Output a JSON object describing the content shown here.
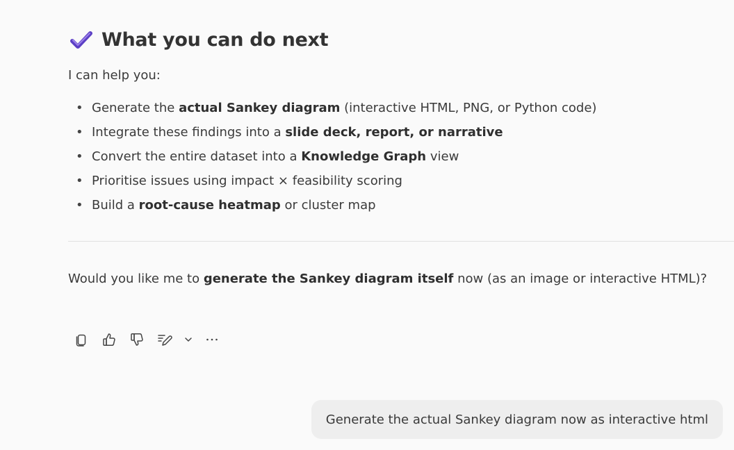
{
  "section": {
    "icon": "checkmark-icon",
    "title": "What you can do next"
  },
  "intro": "I can help you:",
  "options": [
    {
      "pre": "Generate the ",
      "bold": "actual Sankey diagram",
      "post": " (interactive HTML, PNG, or Python code)"
    },
    {
      "pre": "Integrate these findings into a ",
      "bold": "slide deck, report, or narrative",
      "post": ""
    },
    {
      "pre": "Convert the entire dataset into a ",
      "bold": "Knowledge Graph",
      "post": " view"
    },
    {
      "pre": "Prioritise issues using impact × feasibility scoring",
      "bold": "",
      "post": ""
    },
    {
      "pre": "Build a ",
      "bold": "root-cause heatmap",
      "post": " or cluster map"
    }
  ],
  "question": {
    "pre": "Would you like me to ",
    "bold": "generate the Sankey diagram itself",
    "post": " now (as an image or interactive HTML)?"
  },
  "actions": {
    "copy_icon": "copy-icon",
    "like_icon": "thumbs-up-icon",
    "dislike_icon": "thumbs-down-icon",
    "edit_icon": "edit-pen-icon",
    "dropdown_icon": "chevron-down-icon",
    "more_icon": "more-ellipsis-icon"
  },
  "user_message": "Generate the actual Sankey diagram now as interactive html",
  "colors": {
    "check_dark": "#5b3fc4",
    "check_light": "#9a7ee8",
    "background": "#fafafa",
    "bubble": "#eeeeee"
  }
}
